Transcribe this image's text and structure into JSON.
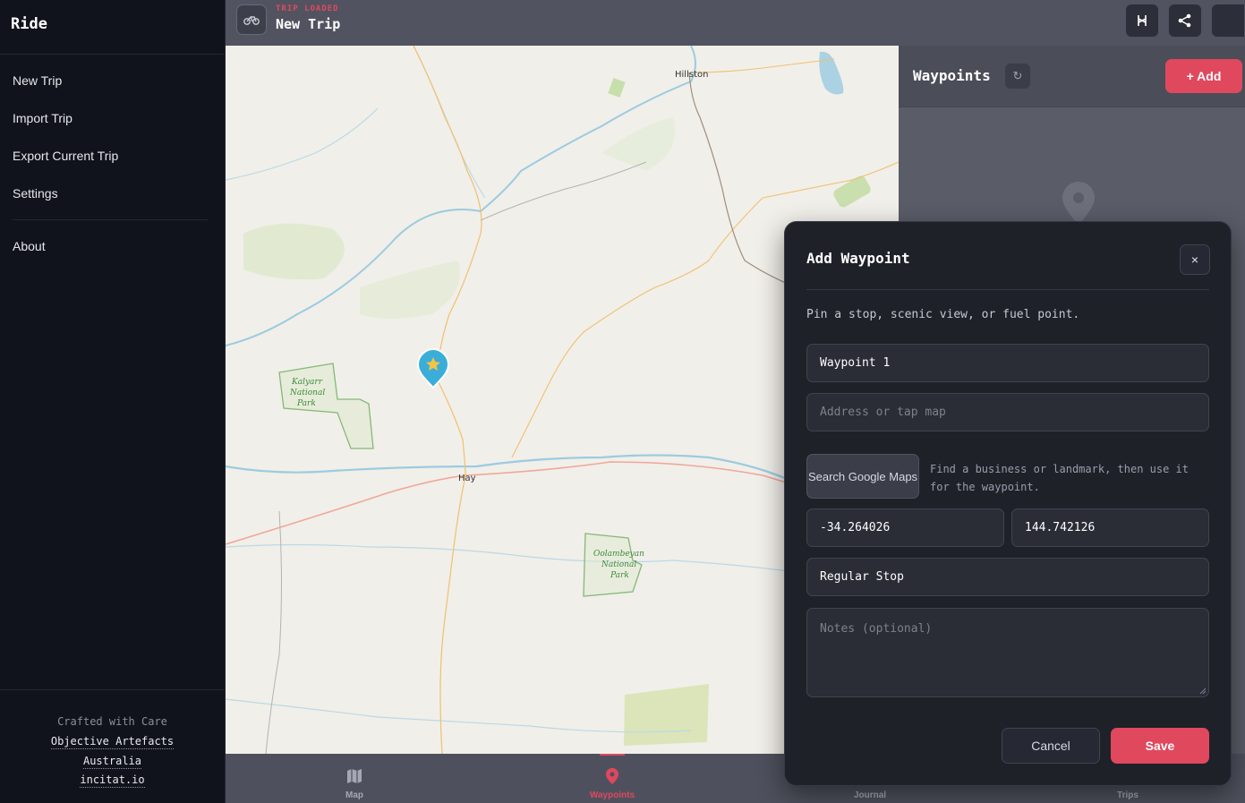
{
  "sidebar": {
    "title": "Ride",
    "menu": [
      "New Trip",
      "Import Trip",
      "Export Current Trip",
      "Settings"
    ],
    "about": "About",
    "footer": {
      "crafted": "Crafted with Care",
      "company": "Objective Artefacts",
      "country": "Australia",
      "site": "incitat.io"
    }
  },
  "header": {
    "status": "TRIP LOADED",
    "trip_name": "New Trip",
    "buttons": [
      "route-icon",
      "share-icon",
      "menu-icon"
    ]
  },
  "map": {
    "places": [
      "Hillston",
      "Hay",
      "Kalyarr",
      "National",
      "Park",
      "Oolambeyan",
      "National",
      "Park"
    ],
    "marker": "star-icon"
  },
  "waypoints_panel": {
    "title": "Waypoints",
    "refresh_icon": "↻",
    "add_label": "+ Add"
  },
  "modal": {
    "title": "Add Waypoint",
    "close_label": "×",
    "description": "Pin a stop, scenic view, or fuel point.",
    "name_value": "Waypoint 1",
    "address_placeholder": "Address or tap map",
    "search_button": "Search Google Maps",
    "search_hint": "Find a business or landmark, then use it for the waypoint.",
    "latitude": "-34.264026",
    "longitude": "144.742126",
    "type_value": "Regular Stop",
    "notes_placeholder": "Notes (optional)",
    "cancel_label": "Cancel",
    "save_label": "Save"
  },
  "bottom_nav": [
    {
      "label": "Map",
      "icon": "map-icon"
    },
    {
      "label": "Waypoints",
      "icon": "pin-icon",
      "active": true
    },
    {
      "label": "Journal",
      "icon": "journal-icon"
    },
    {
      "label": "Trips",
      "icon": "trips-icon"
    }
  ],
  "colors": {
    "accent": "#e0485e",
    "sidebar_bg": "#11131c",
    "modal_bg": "#1f2129",
    "marker": "#3aaed8"
  }
}
